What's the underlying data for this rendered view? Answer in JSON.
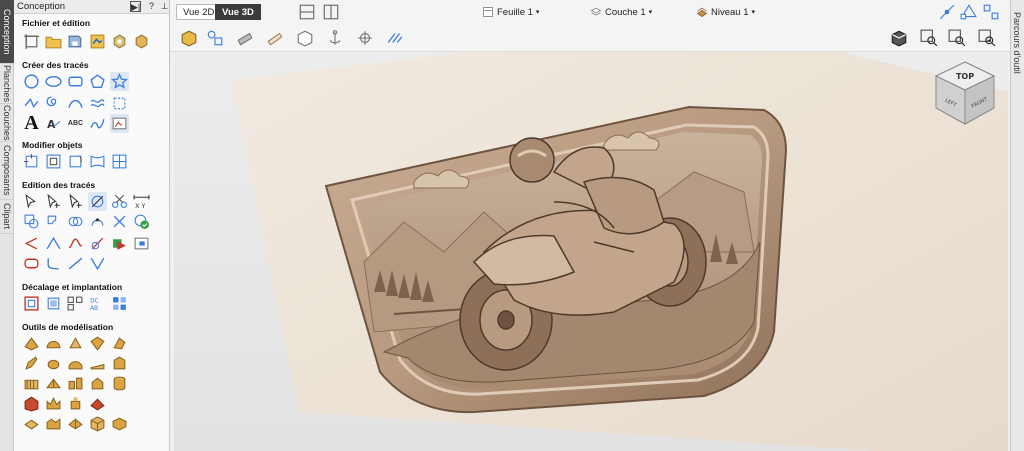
{
  "panel": {
    "title": "Conception",
    "header_buttons": [
      "▶|",
      "?",
      "⊥"
    ],
    "sections": {
      "file": "Fichier et édition",
      "create": "Créer des tracés",
      "modify": "Modifier objets",
      "edit": "Edition des tracés",
      "offset": "Décalage et implantation",
      "modeling": "Outils de modélisation"
    },
    "text_tool_glyph": "A",
    "text_tool_glyph_2": "ABC"
  },
  "vtabs": [
    "Conception",
    "Planches",
    "Couches",
    "Composants",
    "Clipart"
  ],
  "rtabs": [
    "Parcours d'outil"
  ],
  "toolbar": {
    "view_2d": "Vue 2D",
    "view_3d": "Vue 3D",
    "sheet": "Feuille 1",
    "layer": "Couche 1",
    "level": "Niveau 1"
  },
  "cube": {
    "top": "TOP",
    "left": "LEFT",
    "front": "FRONT"
  },
  "colors": {
    "accent": "#3b7ddd",
    "wood": "#b89a82",
    "board": "#ece2d6"
  }
}
